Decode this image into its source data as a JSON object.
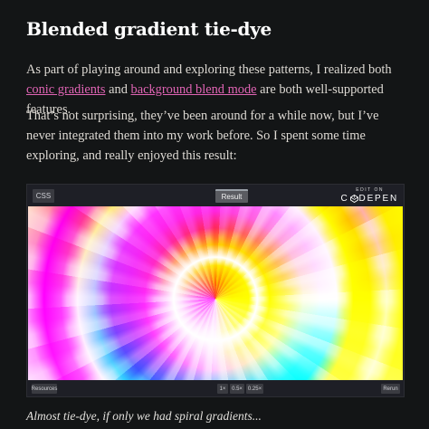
{
  "article": {
    "heading": "Blended gradient tie-dye",
    "para1": {
      "before": "As part of playing around and exploring these patterns, I realized both ",
      "link1": "conic gradients",
      "middle": " and ",
      "link2": "background blend mode",
      "after": " are both well-supported features."
    },
    "para2": "That’s not surprising, they’ve been around for a while now, but I’ve never integrated them into my work before. So I spent some time exploring, and really enjoyed this result:",
    "caption": "Almost tie-dye, if only we had spiral gradients..."
  },
  "embed": {
    "tabs": [
      "CSS",
      "Result"
    ],
    "active_tab": "Result",
    "edit_on": "EDIT ON",
    "brand_left": "C",
    "brand_right": "DEPEN",
    "brand_icon": "codepen-cube-icon",
    "footer_buttons": {
      "resources": "Resources",
      "zoom_1x": "1×",
      "zoom_05x": "0.5×",
      "zoom_025x": "0.25×",
      "rerun": "Rerun"
    }
  },
  "colors": {
    "background": "#131516",
    "link": "#e064b4",
    "heading": "#ffffff",
    "embed_chrome": "#1e1f26"
  }
}
